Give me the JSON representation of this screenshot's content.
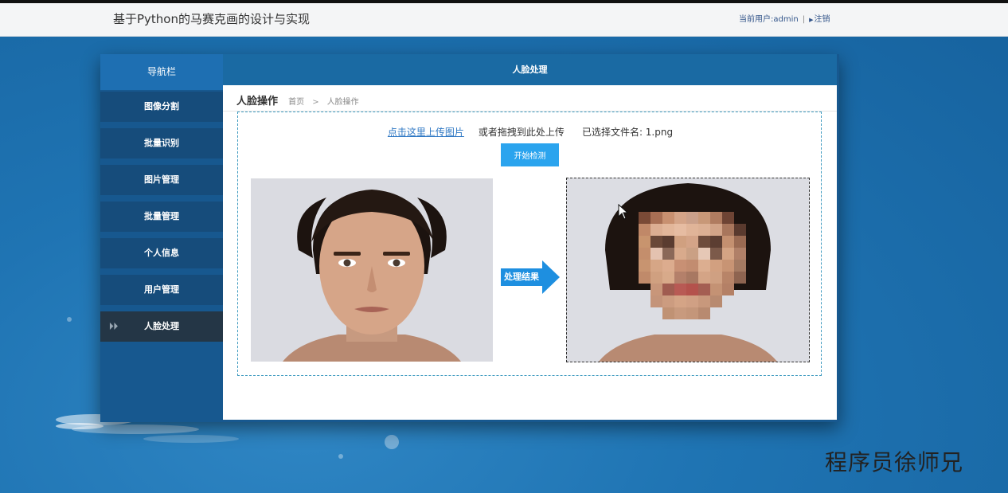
{
  "app": {
    "title": "基于Python的马赛克画的设计与实现"
  },
  "user": {
    "current_user": "当前用户:admin",
    "separator": "|",
    "logout": "注销"
  },
  "sidebar": {
    "title": "导航栏",
    "items": [
      {
        "label": "图像分割",
        "active": false
      },
      {
        "label": "批量识别",
        "active": false
      },
      {
        "label": "图片管理",
        "active": false
      },
      {
        "label": "批量管理",
        "active": false
      },
      {
        "label": "个人信息",
        "active": false
      },
      {
        "label": "用户管理",
        "active": false
      },
      {
        "label": "人脸处理",
        "active": true
      }
    ]
  },
  "main": {
    "header": "人脸处理",
    "page_title": "人脸操作",
    "breadcrumb": {
      "home": "首页",
      "separator": ">",
      "current": "人脸操作"
    },
    "upload": {
      "link": "点击这里上传图片",
      "drag_text": "或者拖拽到此处上传",
      "file_label": "已选择文件名: ",
      "file_name": "1.png"
    },
    "detect_button": "开始检测",
    "arrow_label": "处理结果"
  },
  "watermark": "程序员徐师兄",
  "colors": {
    "accent": "#2ba4ee",
    "sidebar_bg": "#17588f",
    "nav_item_bg": "#164c7b",
    "nav_active_bg": "#243646",
    "link": "#2f78c4"
  },
  "icons": [
    "play-icon",
    "logout-arrow-icon",
    "arrow-right-icon",
    "mouse-cursor-icon"
  ]
}
